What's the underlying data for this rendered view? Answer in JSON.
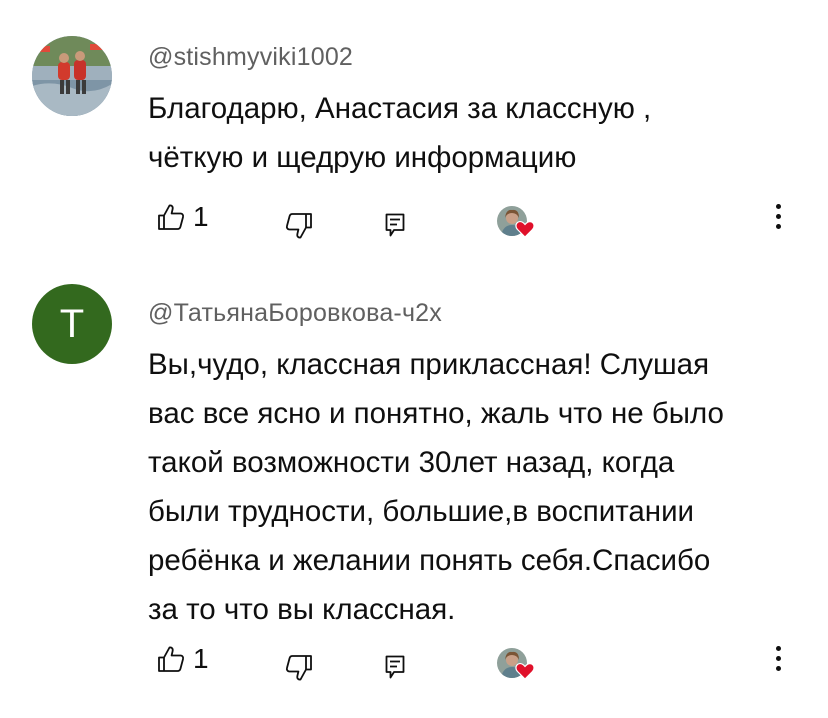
{
  "comments": [
    {
      "author": "@stishmyviki1002",
      "avatar_type": "photo",
      "text_lines": [
        "Благодарю, Анастасия  за классную ,",
        "чёткую и щедрую информацию"
      ],
      "likes": "1",
      "creator_heart": true
    },
    {
      "author": "@ТатьянаБоровкова-ч2х",
      "avatar_type": "letter",
      "avatar_letter": "T",
      "avatar_color": "#33691e",
      "text_lines": [
        "Вы,чудо, классная приклассная! Слушая",
        "вас все ясно и понятно, жаль что не было",
        "такой возможности 30лет назад, когда",
        "были трудности, большие,в воспитании",
        "ребёнка и желании понять себя.Спасибо",
        "за то что вы классная."
      ],
      "likes": "1",
      "creator_heart": true
    }
  ],
  "icons": {
    "like": "thumb-up-icon",
    "dislike": "thumb-down-icon",
    "reply": "reply-comment-icon",
    "more": "more-vertical-icon",
    "heart": "heart-icon"
  },
  "colors": {
    "heart": "#e0102a",
    "handle": "#606060",
    "text": "#0f0f0f"
  }
}
